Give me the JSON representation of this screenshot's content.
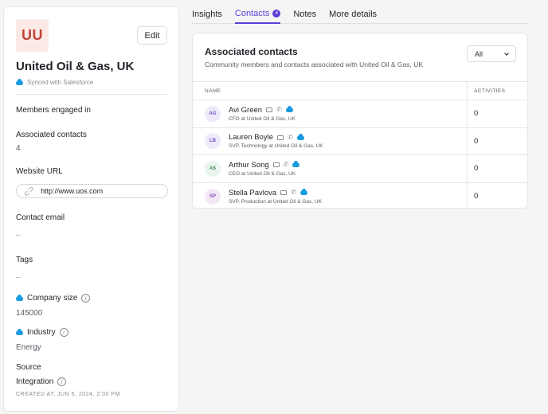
{
  "company": {
    "logo_text": "UU",
    "name": "United Oil & Gas, UK",
    "sync_text": "Synced with Salesforce",
    "edit_label": "Edit"
  },
  "fields": {
    "members_label": "Members engaged in",
    "assoc_label": "Associated contacts",
    "assoc_value": "4",
    "website_label": "Website URL",
    "website_value": "http://www.uos.com",
    "email_label": "Contact email",
    "email_value": "–",
    "tags_label": "Tags",
    "tags_value": "–",
    "size_label": "Company size",
    "size_value": "145000",
    "industry_label": "Industry",
    "industry_value": "Energy",
    "source_label": "Source",
    "source_value": "Integration",
    "created_at": "CREATED AT: JUN 5, 2024, 2:00 PM"
  },
  "tabs": [
    {
      "label": "Insights"
    },
    {
      "label": "Contacts",
      "badge": "4"
    },
    {
      "label": "Notes"
    },
    {
      "label": "More details"
    }
  ],
  "card": {
    "title": "Associated contacts",
    "subtitle": "Community members and contacts associated with United Oil & Gas, UK",
    "filter_value": "All",
    "col_name": "NAME",
    "col_activities": "ACTIVITIES"
  },
  "contacts": [
    {
      "initials": "AG",
      "name": "Avi Green",
      "role": "CFO at United Oil & Gas, UK",
      "activities": "0"
    },
    {
      "initials": "LB",
      "name": "Lauren Boyle",
      "role": "SVP, Technology at United Oil & Gas, UK",
      "activities": "0"
    },
    {
      "initials": "AS",
      "name": "Arthur Song",
      "role": "CEO at United Oil & Gas, UK",
      "activities": "0"
    },
    {
      "initials": "SP",
      "name": "Stella Pavlova",
      "role": "SVP, Production at United Oil & Gas, UK",
      "activities": "0"
    }
  ],
  "colors": {
    "accent": "#5b3fd6",
    "salesforce": "#1a9be0"
  }
}
